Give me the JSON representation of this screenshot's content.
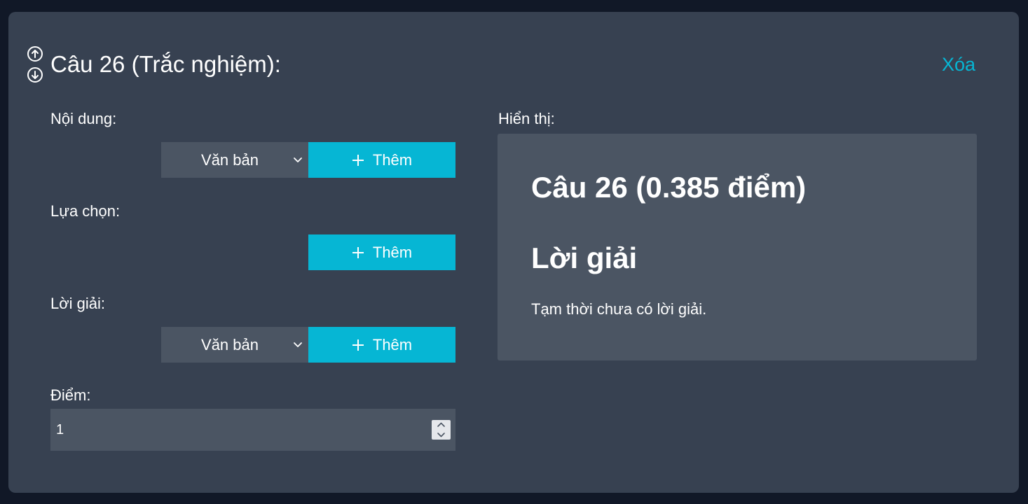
{
  "question": {
    "title": "Câu 26 (Trắc nghiệm):",
    "delete_label": "Xóa"
  },
  "form": {
    "content": {
      "label": "Nội dung:",
      "type_select": "Văn bản",
      "add_label": "Thêm"
    },
    "choices": {
      "label": "Lựa chọn:",
      "add_label": "Thêm"
    },
    "solution": {
      "label": "Lời giải:",
      "type_select": "Văn bản",
      "add_label": "Thêm"
    },
    "points": {
      "label": "Điểm:",
      "value": "1"
    }
  },
  "preview": {
    "label": "Hiển thị:",
    "title": "Câu 26 (0.385 điểm)",
    "solution_heading": "Lời giải",
    "solution_text": "Tạm thời chưa có lời giải."
  },
  "colors": {
    "page_background": "#111827",
    "card_background": "#374151",
    "field_background": "#4b5563",
    "accent": "#06b6d4"
  },
  "icons": {
    "move_up": "arrow-up-circle-icon",
    "move_down": "arrow-down-circle-icon",
    "add": "plus-icon",
    "dropdown": "chevron-down-icon"
  }
}
